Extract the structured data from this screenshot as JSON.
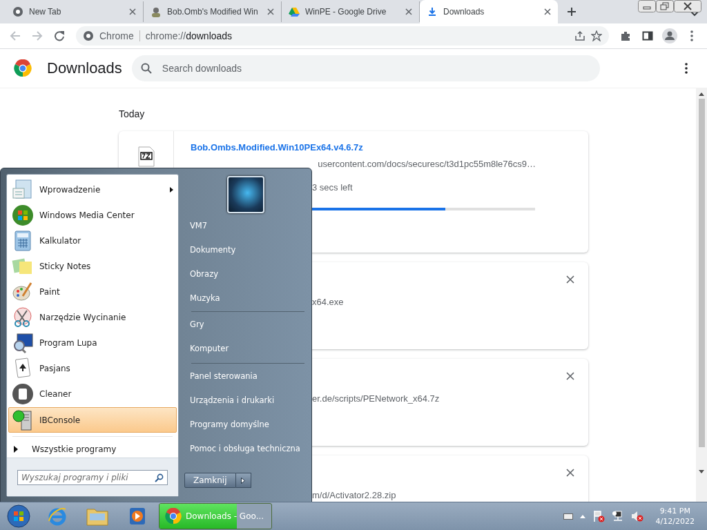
{
  "tabs": [
    {
      "title": "New Tab",
      "selected": false
    },
    {
      "title": "Bob.Omb's Modified Win",
      "selected": false
    },
    {
      "title": "WinPE - Google Drive",
      "selected": false
    },
    {
      "title": "Downloads",
      "selected": true
    }
  ],
  "toolbar": {
    "site_label": "Chrome",
    "url_scheme": "chrome://",
    "url_path": "downloads"
  },
  "page": {
    "title": "Downloads",
    "search": {
      "placeholder": "Search downloads"
    },
    "section": "Today",
    "downloads": [
      {
        "kind": "in_progress",
        "name": "Bob.Ombs.Modified.Win10PEx64.v4.6.7z",
        "url": "usercontent.com/docs/securesc/t3d1pc55m8le76cs9…",
        "status": "3 secs left",
        "level": 0.74
      },
      {
        "kind": "finished",
        "url": "x64.exe"
      },
      {
        "kind": "finished",
        "url": "er.de/scripts/PENetwork_x64.7z"
      },
      {
        "kind": "finished",
        "url": "m/d/Activator2.28.zip"
      }
    ]
  },
  "start_menu": {
    "programs": [
      {
        "label": "Wprowadzenie",
        "submenu": true,
        "selected": false
      },
      {
        "label": "Windows Media Center",
        "submenu": false,
        "selected": false
      },
      {
        "label": "Kalkulator",
        "submenu": false,
        "selected": false
      },
      {
        "label": "Sticky Notes",
        "submenu": false,
        "selected": false
      },
      {
        "label": "Paint",
        "submenu": false,
        "selected": false
      },
      {
        "label": "Narzędzie Wycinanie",
        "submenu": false,
        "selected": false
      },
      {
        "label": "Program Lupa",
        "submenu": false,
        "selected": false
      },
      {
        "label": "Pasjans",
        "submenu": false,
        "selected": false
      },
      {
        "label": "Cleaner",
        "submenu": false,
        "selected": false
      },
      {
        "label": "IBConsole",
        "submenu": false,
        "selected": true
      }
    ],
    "all_programs": "Wszystkie programy",
    "search": {
      "placeholder": "Wyszukaj programy i pliki"
    },
    "places": [
      {
        "items": [
          "VM7",
          "Dokumenty",
          "Obrazy",
          "Muzyka"
        ]
      },
      {
        "items": [
          "Gry",
          "Komputer"
        ]
      },
      {
        "items": [
          "Panel sterowania",
          "Urządzenia i drukarki",
          "Programy domyślne",
          "Pomoc i obsługa techniczna"
        ]
      }
    ],
    "shutdown": "Zamknij"
  },
  "taskbar": {
    "window_button": {
      "label": "Downloads - Goo...",
      "level": 0.69
    },
    "clock": {
      "time": "9:41 PM",
      "date": "4/12/2022"
    }
  }
}
